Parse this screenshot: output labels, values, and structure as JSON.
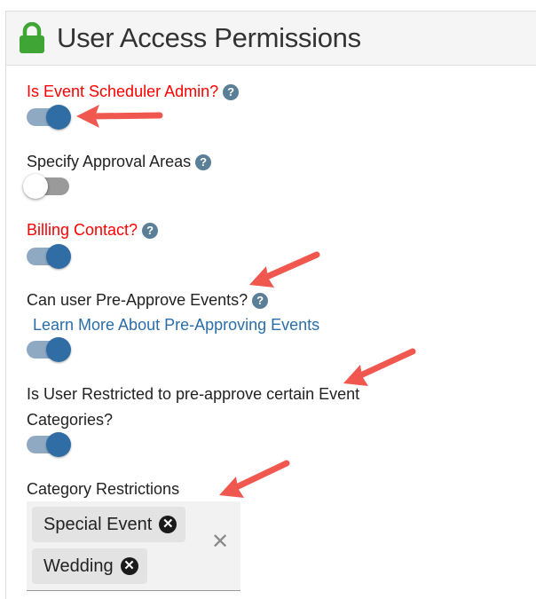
{
  "panel": {
    "title": "User Access Permissions",
    "lock_icon": "lock-icon",
    "lock_color": "#3fa535"
  },
  "fields": {
    "scheduler_admin": {
      "label": "Is Event Scheduler Admin?",
      "label_color": "#ff0000",
      "help": "?",
      "enabled": true
    },
    "approval_areas": {
      "label": "Specify Approval Areas",
      "help": "?",
      "enabled": false
    },
    "billing_contact": {
      "label": "Billing Contact?",
      "label_color": "#ff0000",
      "help": "?",
      "enabled": true
    },
    "pre_approve": {
      "label": "Can user Pre-Approve Events?",
      "help": "?",
      "link": "Learn More About Pre-Approving Events",
      "enabled": true
    },
    "restricted": {
      "label_line1": "Is User Restricted to pre-approve certain Event",
      "label_line2": "Categories?",
      "enabled": true
    },
    "category_restrictions": {
      "label": "Category Restrictions",
      "chips": [
        {
          "label": "Special Event",
          "remove": "✕"
        },
        {
          "label": "Wedding",
          "remove": "✕"
        }
      ],
      "clear": "✕"
    }
  },
  "colors": {
    "toggle_on_thumb": "#2f6da4",
    "toggle_on_track": "#8fa9c3",
    "link": "#2b6ea8",
    "help_icon": "#5a7f96",
    "annotation_arrow": "#f0574f"
  }
}
